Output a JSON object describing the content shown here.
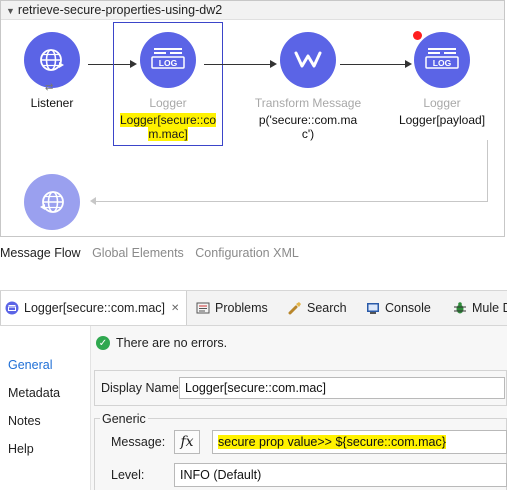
{
  "flow": {
    "title": "retrieve-secure-properties-using-dw2",
    "nodes": [
      {
        "type": "Listener",
        "label": "Listener"
      },
      {
        "type": "Logger",
        "label": "Logger[secure::com.mac]",
        "line1": "Logger[secure::co",
        "line2": "m.mac]"
      },
      {
        "type": "Transform Message",
        "label": "p('secure::com.mac')",
        "line1": "p('secure::com.ma",
        "line2": "c')"
      },
      {
        "type": "Logger",
        "label": "Logger[payload]"
      }
    ],
    "logger_text": "LOG"
  },
  "editor_tabs": [
    "Message Flow",
    "Global Elements",
    "Configuration XML"
  ],
  "panel_tabs": [
    {
      "label": "Logger[secure::com.mac]",
      "close": "✕"
    },
    {
      "label": "Problems"
    },
    {
      "label": "Search"
    },
    {
      "label": "Console"
    },
    {
      "label": "Mule D"
    }
  ],
  "sidebar": [
    "General",
    "Metadata",
    "Notes",
    "Help"
  ],
  "status_message": "There are no errors.",
  "form": {
    "display_name_label": "Display Name:",
    "display_name_value": "Logger[secure::com.mac]",
    "group_title": "Generic",
    "message_label": "Message:",
    "fx_label": "fx",
    "message_value": "secure  prop value>> ${secure::com.mac}",
    "level_label": "Level:",
    "level_value": "INFO (Default)"
  },
  "colors": {
    "node_fill": "#5b64e6",
    "highlight": "#fff200",
    "selection": "#3b45c9",
    "breakpoint": "#ff1f1f"
  }
}
